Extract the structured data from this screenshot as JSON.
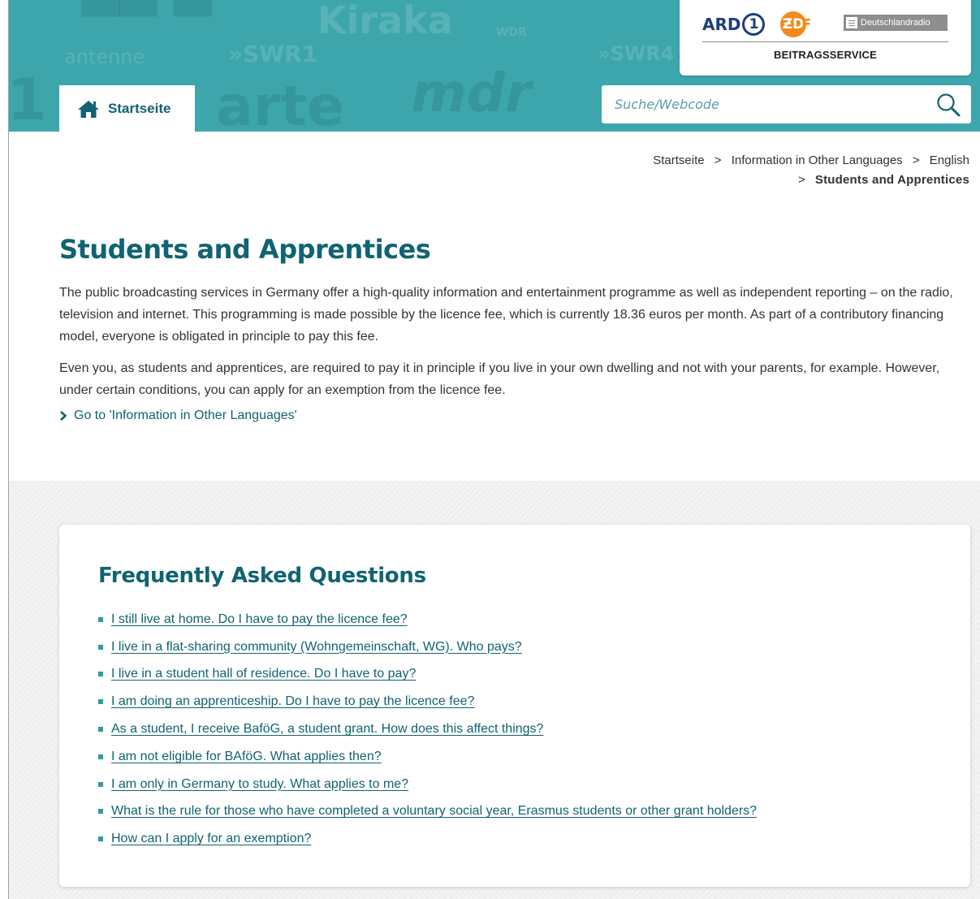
{
  "header": {
    "background_brands": [
      "Kiraka",
      "WDR",
      "antenne",
      "»SWR1",
      "»SWR4",
      "arte",
      "mdr"
    ],
    "home_tab_label": "Startseite",
    "brand_logos": {
      "ard": "ARD",
      "ard_number": "1",
      "zdf_circle": "ƵD",
      "zdf_rest": "F",
      "deutschlandradio": "Deutschlandradio"
    },
    "brand_text": "BEITRAGSSERVICE",
    "search_placeholder": "Suche/Webcode",
    "accent_color": "#3da6ad"
  },
  "breadcrumb": {
    "items": [
      "Startseite",
      "Information in Other Languages",
      "English"
    ],
    "separator": ">",
    "current": "Students and Apprentices"
  },
  "main": {
    "title": "Students and Apprentices",
    "paragraphs": [
      "The public broadcasting services in Germany offer a high-quality information and entertainment programme as well as independent reporting – on the radio, television and internet. This programming is made possible by the licence fee, which is currently 18.36 euros per month. As part of a contributory financing model, everyone is obligated in principle to pay this fee.",
      "Even you, as students and apprentices, are required to pay it in principle if you live in your own dwelling and not with your parents, for example. However, under certain conditions, you can apply for an exemption from the licence fee."
    ],
    "goto_link": "Go to 'Information in Other Languages'",
    "title_color": "#106372"
  },
  "faq": {
    "title": "Frequently Asked Questions",
    "questions": [
      "I still live at home. Do I have to pay the licence fee?",
      "I live in a flat-sharing community (Wohngemeinschaft, WG). Who pays?",
      "I live in a student hall of residence. Do I have to pay?",
      "I am doing an apprenticeship. Do I have to pay the licence fee?",
      "As a student, I receive BaföG, a student grant. How does this affect things?",
      "I am not eligible for BAföG. What applies then?",
      "I am only in Germany to study. What applies to me?",
      "What is the rule for those who have completed a voluntary social year, Erasmus students or other grant holders?",
      "How can I apply for an exemption?"
    ]
  },
  "icons": {
    "home": "home-icon",
    "search": "search-icon",
    "chevron": "chevron-right-icon",
    "bullet": "square-bullet-icon"
  }
}
